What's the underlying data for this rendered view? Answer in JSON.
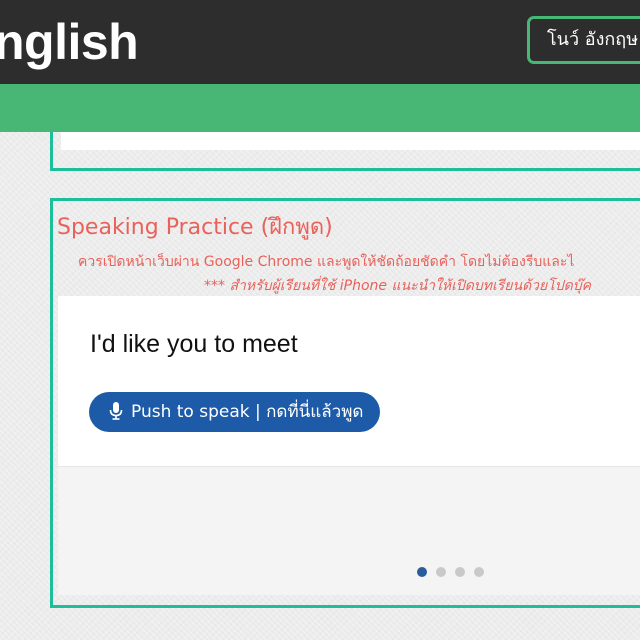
{
  "header": {
    "brand": "nglish",
    "course_button_label": "โนว์ อังกฤษ"
  },
  "speaking": {
    "title": "Speaking Practice (ฝึกพูด)",
    "note_line1": "ควรเปิดหน้าเว็บผ่าน Google Chrome และพูดให้ชัดถ้อยชัดคำ โดยไม่ต้องรีบและไ",
    "note_line2": "*** สำหรับผู้เรียนที่ใช้ iPhone แนะนำให้เปิดบทเรียนด้วยโปดบุ๊ค",
    "phrase": "I'd like you to meet",
    "push_button_label": "Push to speak | กดที่นี่แล้วพูด",
    "pager": {
      "total": 4,
      "active_index": 0
    }
  },
  "colors": {
    "header_bg": "#2d2d2d",
    "green_bar": "#48b674",
    "card_border": "#1dbf9a",
    "title_red": "#e8625a",
    "button_blue": "#1d5ba8",
    "dot_active": "#2a5c9c",
    "dot_inactive": "#c9c9c9"
  },
  "icons": {
    "push_button_icon": "microphone-icon"
  }
}
